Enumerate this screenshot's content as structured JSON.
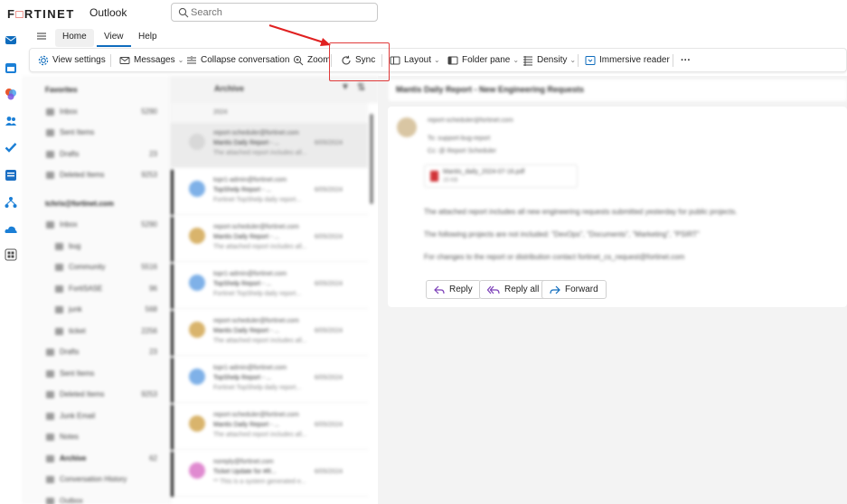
{
  "header": {
    "brand": "FURTINET",
    "app_title": "Outlook",
    "search": {
      "placeholder": "Search"
    }
  },
  "ribbon_tabs": [
    {
      "label": "Home"
    },
    {
      "label": "View",
      "selected": true
    },
    {
      "label": "Help"
    }
  ],
  "ribbon": {
    "view_settings": "View settings",
    "messages": "Messages",
    "collapse_conversation": "Collapse conversation",
    "zoom": "Zoom",
    "sync": "Sync",
    "layout": "Layout",
    "folder_pane": "Folder pane",
    "density": "Density",
    "immersive_reader": "Immersive reader",
    "more": "···"
  },
  "annotation": {
    "highlight_color": "#e03a3a",
    "target": "Sync"
  },
  "folders": {
    "favorites_label": "Favorites",
    "favorites": [
      {
        "name": "Inbox",
        "count": "5290"
      },
      {
        "name": "Sent Items",
        "count": ""
      },
      {
        "name": "Drafts",
        "count": "23"
      },
      {
        "name": "Deleted Items",
        "count": "9253"
      }
    ],
    "account_label": "tchris@fortinet.com",
    "account_folders": [
      {
        "name": "Inbox",
        "count": "5290"
      },
      {
        "name": "bug",
        "count": ""
      },
      {
        "name": "Community",
        "count": "5516"
      },
      {
        "name": "FortiSASE",
        "count": "96"
      },
      {
        "name": "junk",
        "count": "568"
      },
      {
        "name": "ticket",
        "count": "2256"
      },
      {
        "name": "Drafts",
        "count": "23"
      },
      {
        "name": "Sent Items",
        "count": ""
      },
      {
        "name": "Deleted Items",
        "count": "9253"
      },
      {
        "name": "Junk Email",
        "count": ""
      },
      {
        "name": "Notes",
        "count": ""
      },
      {
        "name": "Archive",
        "count": "62"
      },
      {
        "name": "Conversation History",
        "count": ""
      },
      {
        "name": "Outbox",
        "count": ""
      }
    ]
  },
  "message_list": {
    "header_label": "Archive",
    "group_label": "2024",
    "messages": [
      {
        "from": "report-scheduler@fortinet.com",
        "subject": "Mantis Daily Report - ...",
        "date": "6/05/2024",
        "preview": "The attached report includes all...",
        "color": "#d8d8d8"
      },
      {
        "from": "topr1-admin@fortinet.com",
        "subject": "TopShelp Report - ...",
        "date": "6/05/2024",
        "preview": "Fortinet TopShelp daily report...",
        "color": "#7fb1e8"
      },
      {
        "from": "report-scheduler@fortinet.com",
        "subject": "Mantis Daily Report - ...",
        "date": "6/05/2024",
        "preview": "The attached report includes all...",
        "color": "#d9b46c"
      },
      {
        "from": "topr1-admin@fortinet.com",
        "subject": "TopShelp Report - ...",
        "date": "6/05/2024",
        "preview": "Fortinet TopShelp daily report...",
        "color": "#7fb1e8"
      },
      {
        "from": "report-scheduler@fortinet.com",
        "subject": "Mantis Daily Report - ...",
        "date": "6/05/2024",
        "preview": "The attached report includes all...",
        "color": "#d9b46c"
      },
      {
        "from": "topr1-admin@fortinet.com",
        "subject": "TopShelp Report - ...",
        "date": "6/05/2024",
        "preview": "Fortinet TopShelp daily report...",
        "color": "#7fb1e8"
      },
      {
        "from": "report-scheduler@fortinet.com",
        "subject": "Mantis Daily Report - ...",
        "date": "6/05/2024",
        "preview": "The attached report includes all...",
        "color": "#d9b46c"
      },
      {
        "from": "noreply@fortinet.com",
        "subject": "Ticket Update for #R...",
        "date": "6/05/2024",
        "preview": "** This is a system generated e...",
        "color": "#e08ad0"
      }
    ]
  },
  "reading_pane": {
    "subject": "Mantis Daily Report - New Engineering Requests",
    "from": "report-scheduler@fortinet.com",
    "to": "To: support-bug-report",
    "cc": "Cc: @ Report Scheduler",
    "attachment": "Mantis_daily_2024-07-16.pdf",
    "attachment_size": "15 KB",
    "body_lines": [
      "The attached report includes all new engineering requests submitted yesterday for public projects.",
      "The following projects are not included: \"DevOps\", \"Documents\", \"Marketing\", \"PSIRT\"",
      "For changes to the report or distribution contact fortinet_cs_request@fortinet.com"
    ],
    "reply": "Reply",
    "reply_all": "Reply all",
    "forward": "Forward"
  }
}
